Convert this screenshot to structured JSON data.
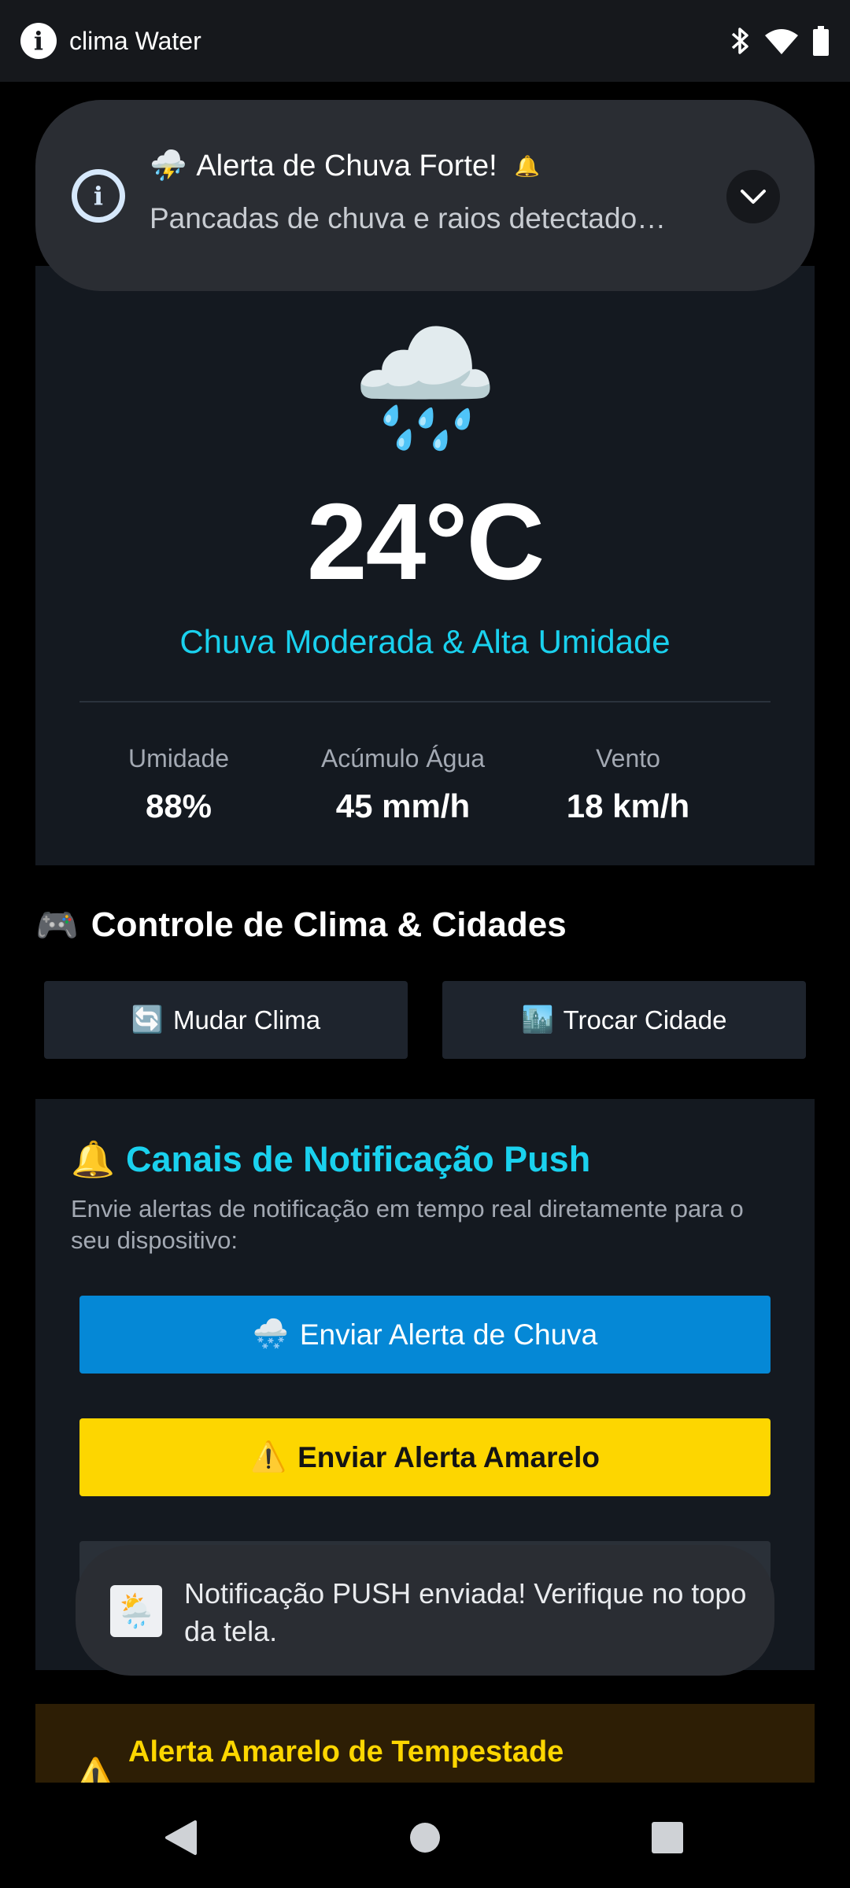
{
  "status_bar": {
    "app_title": "clima Water",
    "icons": [
      "info-icon",
      "bluetooth-icon",
      "wifi-icon",
      "battery-icon"
    ]
  },
  "notification": {
    "emoji": "⛈️",
    "title": "Alerta de Chuva Forte!",
    "text": "Pancadas de chuva e raios detectado…",
    "icons": [
      "info-icon",
      "bell-icon",
      "chevron-down-icon"
    ]
  },
  "weather": {
    "icon_emoji": "🌧️",
    "temperature": "24°C",
    "condition": "Chuva Moderada & Alta Umidade",
    "stats": [
      {
        "label": "Umidade",
        "value": "88%"
      },
      {
        "label": "Acúmulo Água",
        "value": "45 mm/h"
      },
      {
        "label": "Vento",
        "value": "18 km/h"
      }
    ]
  },
  "controls": {
    "emoji": "🎮",
    "title": "Controle de Clima & Cidades",
    "change_weather": {
      "emoji": "🔄",
      "label": "Mudar Clima"
    },
    "change_city": {
      "emoji": "🏙️",
      "label": "Trocar Cidade"
    }
  },
  "push": {
    "emoji": "🔔",
    "title": "Canais de Notificação Push",
    "description": "Envie alertas de notificação em tempo real diretamente para o seu dispositivo:",
    "rain_button": {
      "emoji": "🌨️",
      "label": "Enviar Alerta de Chuva"
    },
    "yellow_button": {
      "emoji": "⚠️",
      "label": "Enviar Alerta Amarelo"
    }
  },
  "toast": {
    "emoji": "🌦️",
    "text": "Notificação PUSH enviada! Verifique no topo da tela."
  },
  "storm_alert": {
    "emoji": "⚠️",
    "title": "Alerta Amarelo de Tempestade"
  },
  "colors": {
    "accent_cyan": "#1ad1ee",
    "rain_button": "#0588d6",
    "yellow_button": "#fdd600",
    "card_bg": "#141920"
  },
  "navigation": {
    "icons": [
      "back-icon",
      "home-icon",
      "recents-icon"
    ]
  }
}
